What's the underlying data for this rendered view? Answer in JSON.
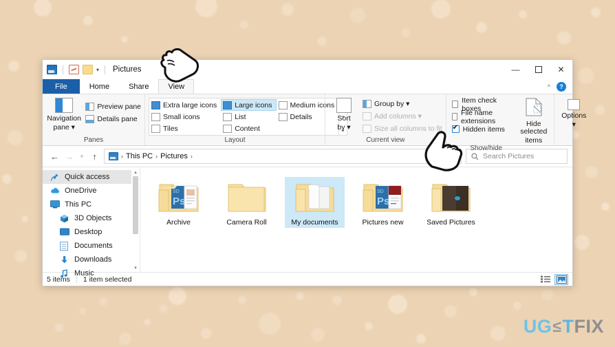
{
  "background": {
    "color": "#ebd3b4",
    "dot_color": "#f6e4cd"
  },
  "window": {
    "titlebar": {
      "title": "Pictures",
      "quick_access": [
        {
          "name": "explorer-icon",
          "label": "File Explorer"
        },
        {
          "name": "properties-icon",
          "label": "Properties"
        },
        {
          "name": "new-folder-icon",
          "label": "New folder"
        },
        {
          "name": "customize-dropdown",
          "label": "▾"
        }
      ],
      "controls": {
        "minimize": "—",
        "maximize": "❐",
        "close": "✕"
      }
    },
    "tabs": [
      {
        "label": "File",
        "type": "file",
        "active": false
      },
      {
        "label": "Home",
        "type": "normal",
        "active": false
      },
      {
        "label": "Share",
        "type": "normal",
        "active": false
      },
      {
        "label": "View",
        "type": "normal",
        "active": true
      }
    ],
    "tab_right": {
      "collapse_label": "^",
      "help_label": "?"
    },
    "ribbon": {
      "panes_group": {
        "label": "Panes",
        "navigation_pane": {
          "line1": "Navigation",
          "line2": "pane ▾"
        },
        "preview_pane": "Preview pane",
        "details_pane": "Details pane"
      },
      "layout_group": {
        "label": "Layout",
        "items": [
          {
            "label": "Extra large icons",
            "selected": false
          },
          {
            "label": "Small icons",
            "selected": false
          },
          {
            "label": "Tiles",
            "selected": false
          },
          {
            "label": "Large icons",
            "selected": true
          },
          {
            "label": "List",
            "selected": false
          },
          {
            "label": "Content",
            "selected": false
          },
          {
            "label": "Medium icons",
            "selected": false
          },
          {
            "label": "Details",
            "selected": false
          }
        ],
        "scroll_up": "▴",
        "scroll_down": "▾",
        "expand": "▾"
      },
      "current_view_group": {
        "label": "Current view",
        "sort_by": {
          "line1": "Sort",
          "line2": "by ▾"
        },
        "group_by": "Group by ▾",
        "add_columns": "Add columns ▾",
        "size_all_columns": "Size all columns to fit"
      },
      "show_hide_group": {
        "label": "Show/hide",
        "item_check_boxes": {
          "label": "Item check boxes",
          "checked": false
        },
        "file_name_extensions": {
          "label": "File name extensions",
          "checked": false
        },
        "hidden_items": {
          "label": "Hidden items",
          "checked": true
        },
        "hide_selected_items": {
          "line1": "Hide selected",
          "line2": "items"
        },
        "options": {
          "line1": "Options",
          "line2": "▾"
        }
      }
    },
    "address_bar": {
      "back": "←",
      "forward": "→",
      "recent": "▾",
      "up": "↑",
      "breadcrumbs": [
        "This PC",
        "Pictures"
      ],
      "trailing_separator": "›",
      "search": {
        "placeholder": "Search Pictures",
        "value": "",
        "icon": "search-icon"
      }
    },
    "sidebar": {
      "items": [
        {
          "label": "Quick access",
          "icon": "pin-icon",
          "indent": false,
          "selected": true
        },
        {
          "label": "OneDrive",
          "icon": "cloud-icon",
          "indent": false,
          "selected": false
        },
        {
          "label": "This PC",
          "icon": "monitor-icon",
          "indent": false,
          "selected": false
        },
        {
          "label": "3D Objects",
          "icon": "cube-icon",
          "indent": true,
          "selected": false
        },
        {
          "label": "Desktop",
          "icon": "desktop-icon",
          "indent": true,
          "selected": false
        },
        {
          "label": "Documents",
          "icon": "documents-icon",
          "indent": true,
          "selected": false
        },
        {
          "label": "Downloads",
          "icon": "download-icon",
          "indent": true,
          "selected": false
        },
        {
          "label": "Music",
          "icon": "music-icon",
          "indent": true,
          "selected": false
        }
      ],
      "scroll_up": "▴",
      "scroll_down": "▾"
    },
    "files": [
      {
        "label": "Archive",
        "type": "folder-photoshop",
        "selected": false
      },
      {
        "label": "Camera Roll",
        "type": "folder-empty",
        "selected": false
      },
      {
        "label": "My documents",
        "type": "folder-documents",
        "selected": true
      },
      {
        "label": "Pictures new",
        "type": "folder-photoshop-red",
        "selected": false
      },
      {
        "label": "Saved Pictures",
        "type": "folder-dark",
        "selected": false
      }
    ],
    "status_bar": {
      "item_count": "5 items",
      "selection": "1 item selected",
      "view_toggles": [
        {
          "name": "details-view-button",
          "selected": false
        },
        {
          "name": "large-icons-view-button",
          "selected": true
        }
      ]
    }
  },
  "annotations": {
    "cursor_ribbon_tab": "pointing-hand-cursor",
    "cursor_hidden_items": "pointing-hand-cursor"
  },
  "logo": {
    "part1": "UG",
    "part2": "≤",
    "part3": "T",
    "part4": "FIX"
  }
}
